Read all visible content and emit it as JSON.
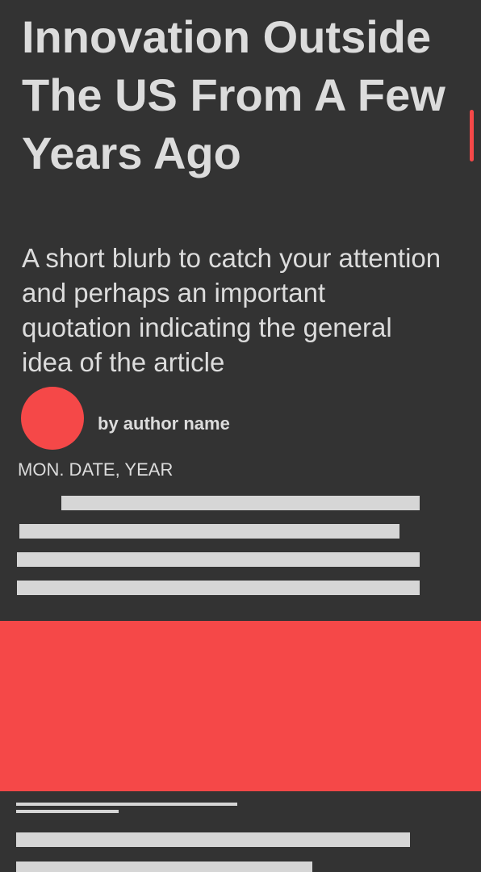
{
  "article": {
    "title": "Innovation Outside The US From A Few Years Ago",
    "blurb": "A short blurb to catch your attention and perhaps an important quotation indicating the general idea of the article",
    "author": "by author name",
    "date": "MON. DATE, YEAR"
  },
  "colors": {
    "background": "#333333",
    "accent": "#f54848",
    "text": "#dcdcdc",
    "placeholder_line": "#d6d6d6"
  }
}
